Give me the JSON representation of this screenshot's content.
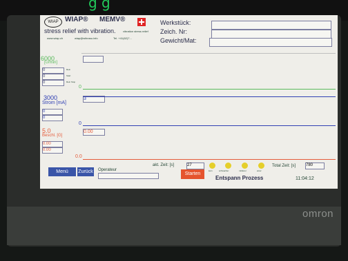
{
  "overlay": {
    "heading": "g g"
  },
  "header": {
    "logo": "WIAP",
    "wiap": "WIAP®",
    "memv": "MEMV®",
    "slogan": "stress relief with vibration.",
    "slogan_small": "vibration stress relief",
    "url": "www.wiap.ch",
    "email": "wiap@wibrasu.info",
    "tel": "Tel. +41(62)7...",
    "fields": [
      {
        "label": "Werkstück:",
        "value": ""
      },
      {
        "label": "Zeich. Nr:",
        "value": ""
      },
      {
        "label": "Gewicht/Mat:",
        "value": ""
      }
    ]
  },
  "panel_top": {
    "max": "6000",
    "unit": "[U/min]",
    "current": "",
    "values": [
      "0",
      "0",
      "0"
    ],
    "value_labels": [
      "Rein",
      "Start",
      "Rein Stop"
    ],
    "zero": "0"
  },
  "panel_mid": {
    "max": "3000",
    "unit": "Strom [mA]",
    "current": "3",
    "values": [
      "0",
      "0"
    ],
    "zero": "0"
  },
  "panel_bot": {
    "max": "5.0",
    "unit": "Beschl. [G]",
    "current": "0.00",
    "values": [
      "0.00",
      "0.00"
    ],
    "zero": "0.0"
  },
  "footer": {
    "menu": "Menü",
    "back": "Zurück",
    "operator_label": "Operateur",
    "time_label": "akt. Zeit: [s]",
    "time_value": "27",
    "status_labels": [
      "kein",
      "schwacher",
      "mittlerer",
      "einer"
    ],
    "start": "Starten",
    "process": "Entspann Prozess",
    "total_time_label": "Total Zeit: [s]",
    "total_time_value": "780",
    "clock": "11:04:12"
  },
  "bezel": {
    "brand": "omron"
  },
  "colors": {
    "green": "#58b95b",
    "blue": "#2f3fb3",
    "red": "#e45b3a",
    "screen": "#efeee9"
  }
}
